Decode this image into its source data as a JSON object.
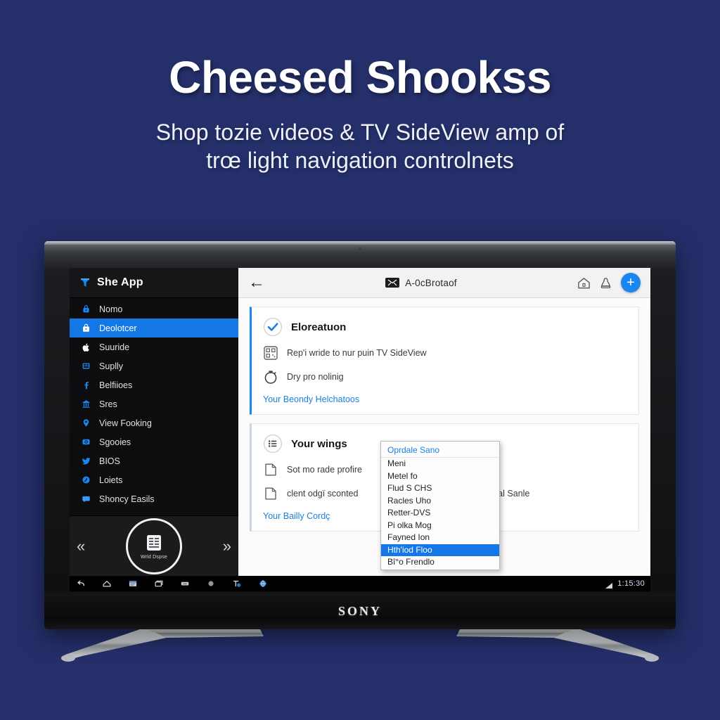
{
  "hero": {
    "title": "Cheesed Shookss",
    "subtitle_line1": "Shop tozie videos & TV SideView amp of",
    "subtitle_line2": "trœ light navigation controlnets"
  },
  "tv": {
    "brand": "SONY"
  },
  "sidebar": {
    "app_title": "She App",
    "items": [
      {
        "label": "Nomo",
        "icon": "lock-icon",
        "active": false
      },
      {
        "label": "Deolotcer",
        "icon": "bag-icon",
        "active": true
      },
      {
        "label": "Suuride",
        "icon": "apple-icon",
        "active": false
      },
      {
        "label": "Suplly",
        "icon": "grid-icon",
        "active": false
      },
      {
        "label": "Belfiioes",
        "icon": "facebook-icon",
        "active": false
      },
      {
        "label": "Sres",
        "icon": "bank-icon",
        "active": false
      },
      {
        "label": "View Fooking",
        "icon": "pin-icon",
        "active": false
      },
      {
        "label": "Sgooies",
        "icon": "camera-icon",
        "active": false
      },
      {
        "label": "BIOS",
        "icon": "twitter-icon",
        "active": false
      },
      {
        "label": "Loiets",
        "icon": "disc-icon",
        "active": false
      },
      {
        "label": "Shoncy Easils",
        "icon": "chat-icon",
        "active": false
      }
    ],
    "footer": {
      "prev_label": "«",
      "next_label": "»",
      "dial_label": "Wrld Dspse",
      "dial_icon": "document-list-icon"
    }
  },
  "appbar": {
    "back_icon": "back-arrow-icon",
    "badge_icon": "mail-icon",
    "title": "A-0cBrotaof",
    "home_icon": "home-icon",
    "person_icon": "person-icon",
    "add_label": "+"
  },
  "cards": [
    {
      "title": "Eloreatuon",
      "title_icon": "check-circle-icon",
      "rows": [
        {
          "icon": "qr-code-icon",
          "text": "Rep'i wride to nur puin TV SideView"
        },
        {
          "icon": "timer-icon",
          "text": "Dry pro nolinig"
        }
      ],
      "link": "Your Beondy Helchatoos"
    },
    {
      "title": "Your wings",
      "title_icon": "list-circle-icon",
      "rows": [
        {
          "icon": "file-icon",
          "text": "Sot mo rade profire"
        },
        {
          "icon": "file-icon",
          "text": "clent odgï sconted",
          "trailing": "lagal Sanle"
        }
      ],
      "link": "Your Bailly Cordç"
    }
  ],
  "dropdown": {
    "header": "Oprdale Sano",
    "items": [
      {
        "label": "Meni",
        "selected": false
      },
      {
        "label": "Metel fo",
        "selected": false
      },
      {
        "label": "Flud S CHS",
        "selected": false
      },
      {
        "label": "Racles Uho",
        "selected": false
      },
      {
        "label": "Retter-DVS",
        "selected": false
      },
      {
        "label": "Pi olka Mog",
        "selected": false
      },
      {
        "label": "Fayned Ion",
        "selected": false
      },
      {
        "label": "Hth'iod Floo",
        "selected": true
      },
      {
        "label": "Bî°o Frendlo",
        "selected": false
      }
    ]
  },
  "navbar": {
    "icons": [
      "back-icon",
      "home-icon",
      "screenshot-icon",
      "recents-icon",
      "keyboard-icon",
      "circle-icon",
      "settings-blue-icon",
      "globe-icon"
    ],
    "signal_icon": "signal-icon",
    "clock": "1:15:30"
  },
  "colors": {
    "background": "#25306b",
    "accent": "#1a86f0",
    "sidebar_bg": "#0d0d0f",
    "selected_row": "#1477e6"
  }
}
